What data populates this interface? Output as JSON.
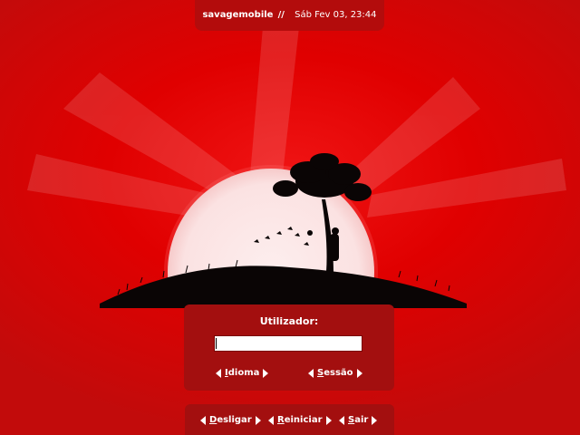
{
  "top_bar": {
    "host": "savagemobile",
    "separator": "//",
    "datetime": "Sáb Fev 03, 23:44"
  },
  "login": {
    "label": "Utilizador:",
    "input_value": "",
    "options": {
      "language": {
        "mnemonic": "I",
        "rest": "dioma"
      },
      "session": {
        "mnemonic": "S",
        "rest": "essão"
      }
    }
  },
  "power": {
    "shutdown": {
      "mnemonic": "D",
      "rest": "esligar"
    },
    "restart": {
      "mnemonic": "R",
      "rest": "einiciar"
    },
    "quit": {
      "mnemonic": "S",
      "rest": "air"
    }
  },
  "colors": {
    "background": "#e00000",
    "panel": "#a30f0f",
    "sun": "#fbe7e7",
    "silhouette": "#0a0505"
  }
}
